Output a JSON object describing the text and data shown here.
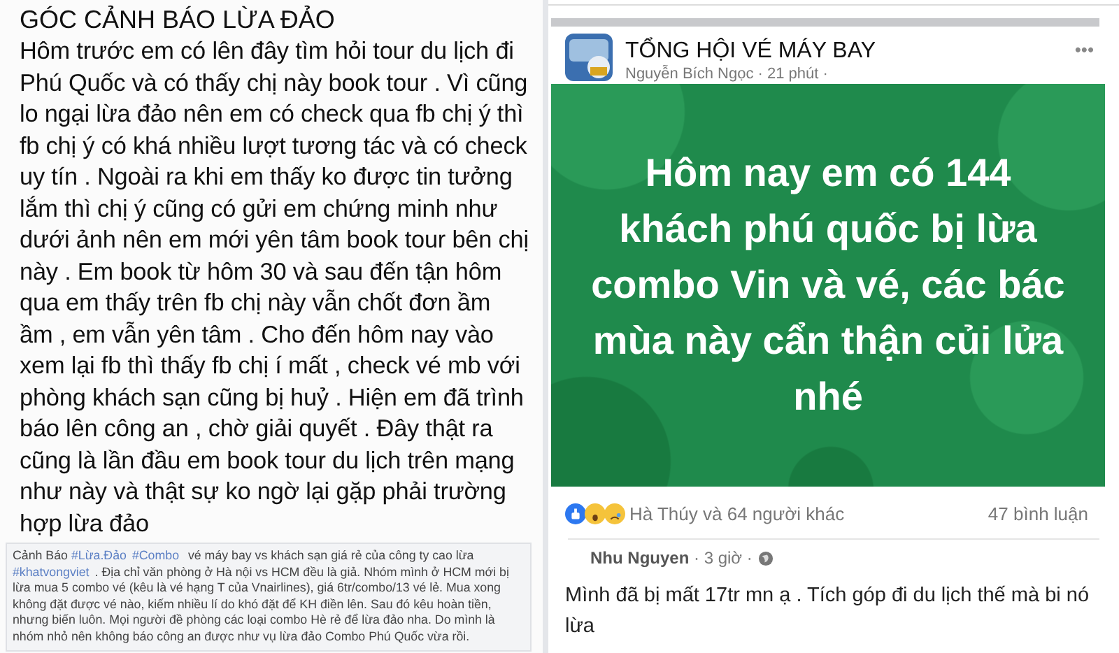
{
  "left_post": {
    "title": "GÓC CẢNH BÁO LỪA ĐẢO",
    "body": "Hôm trước em có lên đây tìm hỏi tour du lịch đi Phú Quốc và có thấy chị này book tour . Vì cũng lo ngại lừa đảo nên em có check qua fb chị ý thì fb chị ý có khá nhiều lượt tương tác và có check uy tín . Ngoài ra khi em thấy ko được tin tưởng lắm thì chị ý cũng có gửi em chứng minh như dưới ảnh nên em mới yên tâm book tour bên chị này . Em book từ hôm 30 và sau đến tận hôm qua em thấy trên fb chị này vẫn chốt đơn ầm ầm , em vẫn yên tâm . Cho đến hôm nay vào xem lại fb thì thấy fb chị í mất , check vé mb với phòng khách sạn cũng bị huỷ . Hiện em đã trình báo lên công an , chờ giải quyết . Đây thật ra cũng là lần đầu em book tour du lịch trên mạng như này và thật sự ko ngờ lại gặp phải trường hợp lừa đảo"
  },
  "small_post": {
    "segments": [
      {
        "kind": "text",
        "text": "Cảnh Báo "
      },
      {
        "kind": "hashtag",
        "text": "#Lừa.Đảo"
      },
      {
        "kind": "hashtag",
        "text": "#Combo"
      },
      {
        "kind": "text",
        "text": " vé máy bay vs khách sạn giá rẻ của công ty cao lừa "
      },
      {
        "kind": "hashtag",
        "text": "#khatvongviet"
      },
      {
        "kind": "text",
        "text": ". Địa chỉ văn phòng ở Hà nội vs HCM đều là giả. Nhóm mình ở HCM mới bị lừa mua 5 combo vé (kêu là vé hạng T của Vnairlines), giá 6tr/combo/13 vé lẻ. Mua xong không đặt được vé nào, kiếm nhiều lí do khó đặt để KH điền lên. Sau đó kêu hoàn tiền, nhưng biến luôn. Mọi người đề phòng các loại combo Hè rẻ để lừa đảo nha. Do mình là nhóm nhỏ nên không báo công an được như vụ lừa đảo Combo Phú Quốc vừa rồi."
      }
    ]
  },
  "right_post": {
    "group": "TỔNG HỘI VÉ MÁY BAY",
    "meta": "Nguyễn Bích Ngọc · 21 phút ·",
    "menu": "•••",
    "card_text": "Hôm nay em có 144 khách phú quốc bị lừa combo Vin và vé, các bác mùa này cẩn thận củi lửa nhé",
    "reactions": "Hà Thúy và 64 người khác",
    "comments_count": "47 bình luận",
    "comment": {
      "meta": "**Nhu Nguyen** · 3 giờ ·",
      "text": "Mình đã bị mất 17tr mn ạ . Tích góp đi du lịch thế mà bi nó lừa"
    }
  }
}
